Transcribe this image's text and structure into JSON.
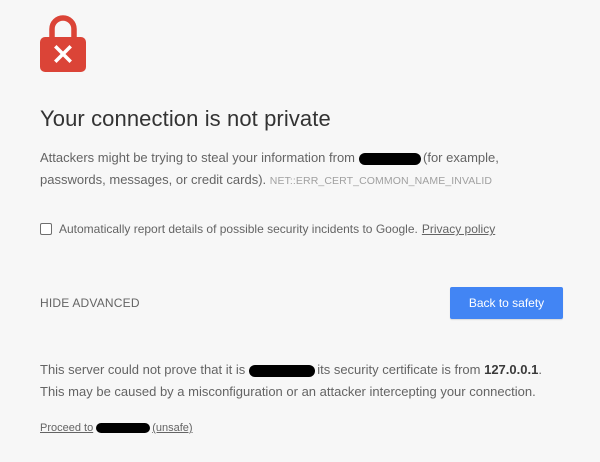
{
  "colors": {
    "lock": "#db4437",
    "button": "#4285f4",
    "background": "#f7f7f7"
  },
  "icon": "lock-error-icon",
  "heading": "Your connection is not private",
  "warning": {
    "text_before": "Attackers might be trying to steal your information from",
    "text_after": "(for example, passwords, messages, or credit cards).",
    "error_code": "NET::ERR_CERT_COMMON_NAME_INVALID"
  },
  "report": {
    "label": "Automatically report details of possible security incidents to Google.",
    "privacy_link": "Privacy policy",
    "checked": false
  },
  "hide_advanced": "HIDE ADVANCED",
  "back_button": "Back to safety",
  "details": {
    "text_before": "This server could not prove that it is",
    "text_middle": "its security certificate is from",
    "ip": "127.0.0.1",
    "text_after": ". This may be caused by a misconfiguration or an attacker intercepting your connection."
  },
  "proceed": {
    "prefix": "Proceed to",
    "suffix": "(unsafe)"
  }
}
